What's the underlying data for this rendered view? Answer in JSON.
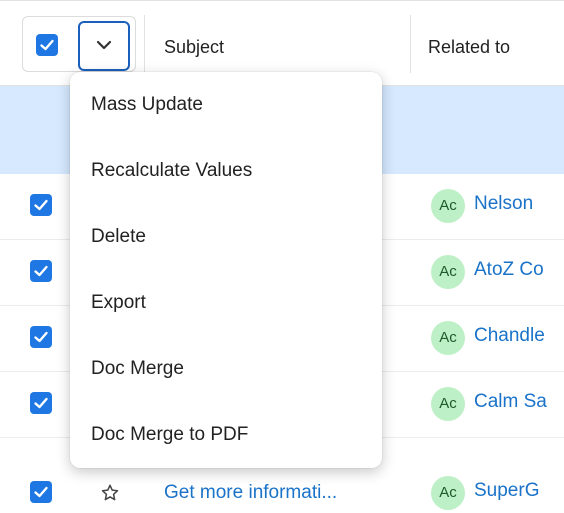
{
  "header": {
    "columns": {
      "subject": "Subject",
      "related_to": "Related to"
    },
    "select_all_checked": true
  },
  "menu": {
    "items": [
      {
        "label": "Mass Update"
      },
      {
        "label": "Recalculate Values"
      },
      {
        "label": "Delete"
      },
      {
        "label": "Export"
      },
      {
        "label": "Doc Merge"
      },
      {
        "label": "Doc Merge to PDF"
      }
    ]
  },
  "rows": [
    {
      "checked": true,
      "related_badge": "Ac",
      "related_name": "Nelson"
    },
    {
      "checked": true,
      "related_badge": "Ac",
      "related_name": "AtoZ Co"
    },
    {
      "checked": true,
      "related_badge": "Ac",
      "related_name": "Chandle"
    },
    {
      "checked": true,
      "related_badge": "Ac",
      "related_name": "Calm Sa"
    },
    {
      "checked": true,
      "subject": "Get more informati...",
      "related_badge": "Ac",
      "related_name": "SuperG"
    }
  ],
  "colors": {
    "accent": "#1e77e3",
    "selection_bar": "#d6e9ff",
    "link": "#1a73c9",
    "avatar_bg": "#bdf0c6"
  }
}
